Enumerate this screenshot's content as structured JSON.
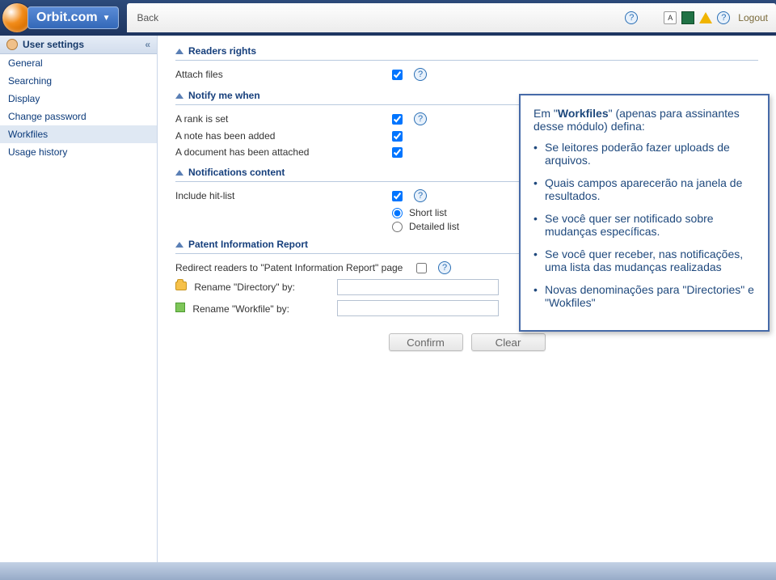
{
  "header": {
    "brand": "Orbit.com",
    "back": "Back",
    "logout": "Logout"
  },
  "sidebar": {
    "title": "User settings",
    "collapse": "«",
    "items": [
      "General",
      "Searching",
      "Display",
      "Change password",
      "Workfiles",
      "Usage history"
    ],
    "active_index": 4
  },
  "sections": {
    "readers_rights": {
      "title": "Readers rights",
      "attach_files": "Attach files",
      "attach_files_checked": true
    },
    "notify": {
      "title": "Notify me when",
      "rank": "A rank is set",
      "rank_checked": true,
      "note": "A note has been added",
      "note_checked": true,
      "doc": "A document has been attached",
      "doc_checked": true
    },
    "notif_content": {
      "title": "Notifications content",
      "include": "Include hit-list",
      "include_checked": true,
      "short": "Short list",
      "detailed": "Detailed list",
      "selected": "short"
    },
    "pir": {
      "title": "Patent Information Report",
      "redirect": "Redirect readers to \"Patent Information Report\" page",
      "redirect_checked": false,
      "rename_dir": "Rename \"Directory\" by:",
      "rename_wf": "Rename \"Workfile\" by:",
      "dir_value": "",
      "wf_value": ""
    }
  },
  "buttons": {
    "confirm": "Confirm",
    "clear": "Clear"
  },
  "callout": {
    "intro_1": "Em \"",
    "intro_bold": "Workfiles",
    "intro_2": "\" (apenas para assinantes  desse módulo) defina:",
    "b1": "Se leitores poderão fazer uploads de arquivos.",
    "b2": "Quais campos aparecerão na janela de resultados.",
    "b3": "Se você quer ser notificado sobre mudanças específicas.",
    "b4": "Se você quer receber, nas notificações,  uma lista das mudanças realizadas",
    "b5": "Novas denominações para \"Directories\" e \"Wokfiles\""
  }
}
